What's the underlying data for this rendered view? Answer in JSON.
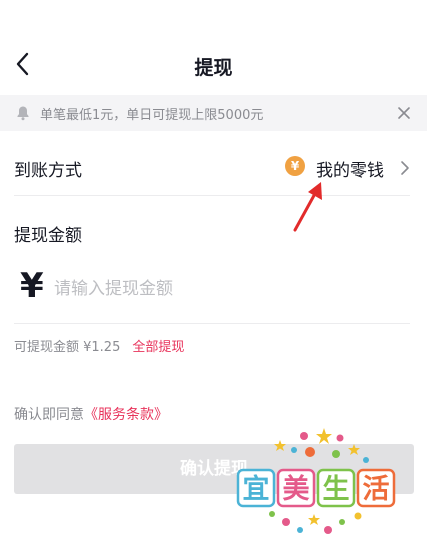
{
  "header": {
    "title": "提现"
  },
  "notice": {
    "text": "单笔最低1元，单日可提现上限5000元"
  },
  "method": {
    "label": "到账方式",
    "badge": "¥",
    "value": "我的零钱"
  },
  "amount": {
    "title": "提现金额",
    "currency": "¥",
    "placeholder": "请输入提现金额"
  },
  "available": {
    "text": "可提现金额 ¥1.25",
    "withdraw_all": "全部提现"
  },
  "agree": {
    "prefix": "确认即同意",
    "terms": "《服务条款》"
  },
  "confirm": {
    "label": "确认提现"
  },
  "watermark": {
    "chars": [
      "宜",
      "美",
      "生",
      "活"
    ]
  },
  "colors": {
    "accent": "#e8335b",
    "badge": "#f0a142",
    "annotation": "#e22b2b",
    "button_disabled": "#e1e1e3"
  }
}
